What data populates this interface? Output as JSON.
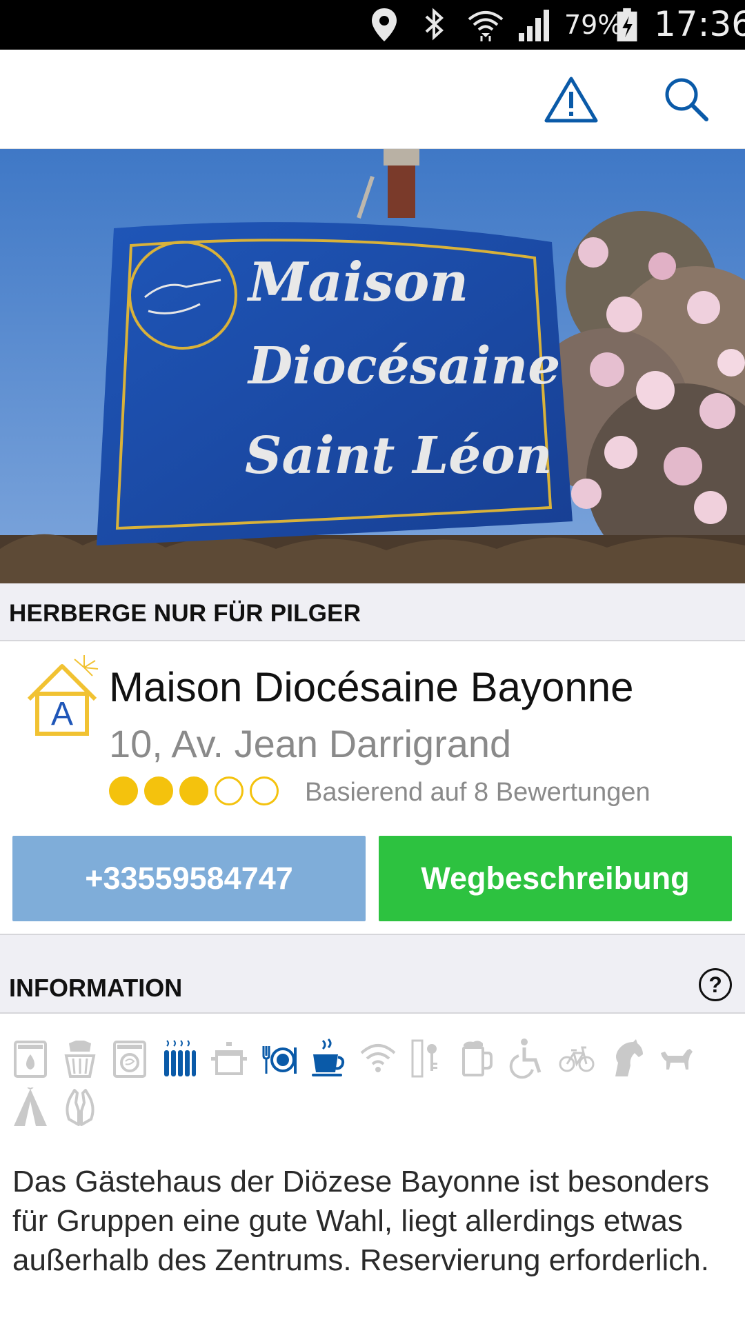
{
  "status_bar": {
    "icons": [
      "location-icon",
      "bluetooth-icon",
      "wifi-icon",
      "cell-signal-icon",
      "battery-charging-icon"
    ],
    "battery_percent": "79%",
    "time": "17:36"
  },
  "toolbar": {
    "actions": [
      "warning-icon",
      "search-icon"
    ],
    "accent_color": "#0a5aa8"
  },
  "hero": {
    "sign_lines": [
      "Maison",
      "Diocésaine",
      "Saint Léon"
    ]
  },
  "category": "HERBERGE NUR FÜR PILGER",
  "listing": {
    "name": "Maison Diocésaine Bayonne",
    "address": "10, Av. Jean Darrigrand",
    "logo_letter": "A",
    "rating": 3,
    "rating_max": 5,
    "review_text": "Basierend auf 8 Bewertungen",
    "phone": "+33559584747",
    "directions": "Wegbeschreibung"
  },
  "info": {
    "title": "INFORMATION",
    "help_icon": "?"
  },
  "amenities": [
    {
      "icon": "washing-machine-icon",
      "active": false
    },
    {
      "icon": "laundry-basket-icon",
      "active": false
    },
    {
      "icon": "dryer-icon",
      "active": false
    },
    {
      "icon": "heating-icon",
      "active": true
    },
    {
      "icon": "cooking-pot-icon",
      "active": false
    },
    {
      "icon": "meals-icon",
      "active": true
    },
    {
      "icon": "breakfast-icon",
      "active": true
    },
    {
      "icon": "wifi-icon",
      "active": false
    },
    {
      "icon": "lockers-icon",
      "active": false
    },
    {
      "icon": "bar-icon",
      "active": false
    },
    {
      "icon": "wheelchair-icon",
      "active": false
    },
    {
      "icon": "bicycle-icon",
      "active": false
    },
    {
      "icon": "horse-icon",
      "active": false
    },
    {
      "icon": "dog-icon",
      "active": false
    },
    {
      "icon": "tent-icon",
      "active": false
    },
    {
      "icon": "prayer-icon",
      "active": false
    }
  ],
  "colors": {
    "amenity_active": "#0a5aa8",
    "amenity_inactive": "#c9c9c9",
    "rating": "#f4c20d",
    "phone_button": "#7fadd9",
    "directions_button": "#2dc240"
  },
  "description": "Das Gästehaus der Diözese Bayonne ist besonders für Gruppen eine gute Wahl, liegt allerdings etwas außerhalb des Zentrums. Reservierung erforderlich."
}
